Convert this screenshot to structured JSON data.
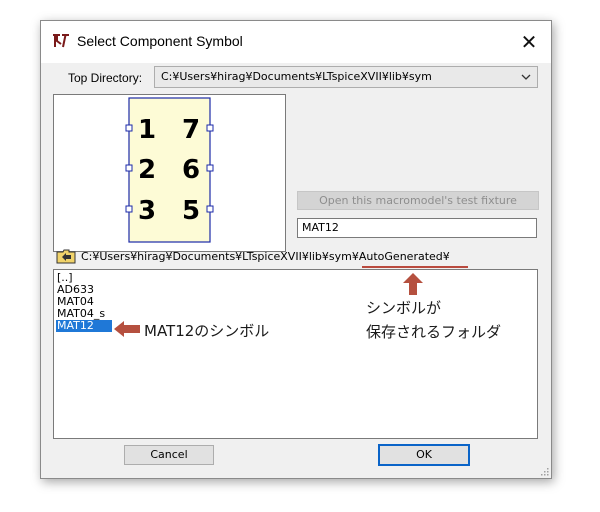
{
  "window": {
    "title": "Select Component Symbol",
    "close_glyph": "✕"
  },
  "top_directory": {
    "label": "Top Directory:",
    "value": "C:¥Users¥hirag¥Documents¥LTspiceXVII¥lib¥sym"
  },
  "preview": {
    "pins_left": [
      "1",
      "2",
      "3"
    ],
    "pins_right": [
      "7",
      "6",
      "5"
    ]
  },
  "macro_button": {
    "label": "Open this macromodel's test fixture",
    "enabled": false
  },
  "symbol_name_field": {
    "value": "MAT12"
  },
  "current_path": "C:¥Users¥hirag¥Documents¥LTspiceXVII¥lib¥sym¥AutoGenerated¥",
  "file_list": {
    "items": [
      "[..]",
      "AD633",
      "MAT04",
      "MAT04_s",
      "MAT12"
    ],
    "selected": "MAT12"
  },
  "buttons": {
    "cancel": "Cancel",
    "ok": "OK"
  },
  "annotations": {
    "symbol_note": "MAT12のシンボル",
    "folder_note_line1": "シンボルが",
    "folder_note_line2": "保存されるフォルダ",
    "arrow_color": "#b5503f"
  }
}
